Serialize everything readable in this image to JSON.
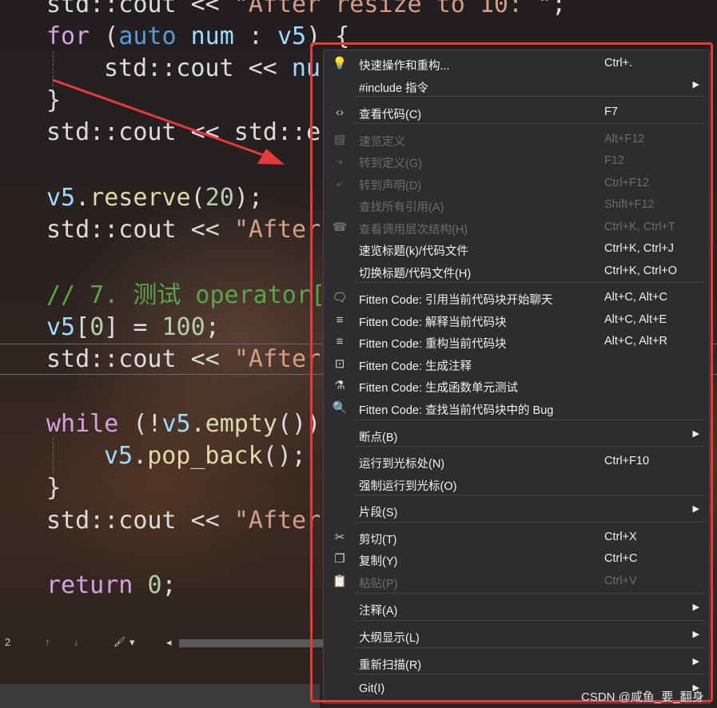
{
  "code": {
    "line1": {
      "a": "std::cout << ",
      "b": "\"After resize to 10: \"",
      "c": ";"
    },
    "line2": {
      "kw": "for",
      "a": " (",
      "auto": "auto",
      "sp": " ",
      "num": "num",
      "c": " : ",
      "v5": "v5",
      "d": ") {"
    },
    "line3": {
      "a": "std::cout << ",
      "b": "nu"
    },
    "line4": "}",
    "line5": {
      "a": "std::cout << std::e"
    },
    "line6": {
      "v5": "v5",
      "a": ".",
      "fn": "reserve",
      "b": "(",
      "num": "20",
      "c": ");"
    },
    "line7": {
      "a": "std::cout << ",
      "b": "\"After"
    },
    "line8": "// 7. 测试 operator[",
    "line9": {
      "v5": "v5",
      "a": "[",
      "i": "0",
      "b": "] = ",
      "num": "100",
      "c": ";"
    },
    "line10": {
      "a": "std::cout << ",
      "b": "\"After"
    },
    "line11": {
      "kw": "while",
      "a": " (!",
      "v5": "v5",
      "b": ".",
      "fn": "empty",
      "c": "())"
    },
    "line12": {
      "v5": "v5",
      "a": ".",
      "fn": "pop_back",
      "b": "();"
    },
    "line13": "}",
    "line14": {
      "a": "std::cout << ",
      "b": "\"After"
    },
    "line15": {
      "kw": "return",
      "a": " ",
      "num": "0",
      "b": ";"
    }
  },
  "statusbar": {
    "line_num": "2",
    "up": "↑",
    "down": "↓",
    "brush": "🖌",
    "dropdown": "▾",
    "left": "◂"
  },
  "menu": {
    "items": [
      {
        "icon": "💡",
        "label": "快速操作和重构...",
        "shortcut": "Ctrl+.",
        "submenu": false,
        "disabled": false
      },
      {
        "icon": "",
        "label": "#include 指令",
        "shortcut": "",
        "submenu": true,
        "disabled": false
      },
      {
        "icon": "‹›",
        "label": "查看代码(C)",
        "shortcut": "F7",
        "submenu": false,
        "disabled": false
      },
      {
        "icon": "▤",
        "label": "速览定义",
        "shortcut": "Alt+F12",
        "submenu": false,
        "disabled": true
      },
      {
        "icon": "⤷",
        "label": "转到定义(G)",
        "shortcut": "F12",
        "submenu": false,
        "disabled": true
      },
      {
        "icon": "⤶",
        "label": "转到声明(D)",
        "shortcut": "Ctrl+F12",
        "submenu": false,
        "disabled": true
      },
      {
        "icon": "",
        "label": "查找所有引用(A)",
        "shortcut": "Shift+F12",
        "submenu": false,
        "disabled": true
      },
      {
        "icon": "☎",
        "label": "查看调用层次结构(H)",
        "shortcut": "Ctrl+K, Ctrl+T",
        "submenu": false,
        "disabled": true
      },
      {
        "icon": "",
        "label": "速览标题(k)/代码文件",
        "shortcut": "Ctrl+K, Ctrl+J",
        "submenu": false,
        "disabled": false
      },
      {
        "icon": "",
        "label": "切换标题/代码文件(H)",
        "shortcut": "Ctrl+K, Ctrl+O",
        "submenu": false,
        "disabled": false
      },
      {
        "icon": "🗨",
        "label": "Fitten Code: 引用当前代码块开始聊天",
        "shortcut": "Alt+C, Alt+C",
        "submenu": false,
        "disabled": false
      },
      {
        "icon": "≡",
        "label": "Fitten Code: 解释当前代码块",
        "shortcut": "Alt+C, Alt+E",
        "submenu": false,
        "disabled": false
      },
      {
        "icon": "≡",
        "label": "Fitten Code: 重构当前代码块",
        "shortcut": "Alt+C, Alt+R",
        "submenu": false,
        "disabled": false
      },
      {
        "icon": "⊡",
        "label": "Fitten Code: 生成注释",
        "shortcut": "",
        "submenu": false,
        "disabled": false
      },
      {
        "icon": "⚗",
        "label": "Fitten Code: 生成函数单元测试",
        "shortcut": "",
        "submenu": false,
        "disabled": false
      },
      {
        "icon": "🔍",
        "label": "Fitten Code: 查找当前代码块中的 Bug",
        "shortcut": "",
        "submenu": false,
        "disabled": false
      },
      {
        "icon": "",
        "label": "断点(B)",
        "shortcut": "",
        "submenu": true,
        "disabled": false
      },
      {
        "icon": "",
        "label": "运行到光标处(N)",
        "shortcut": "Ctrl+F10",
        "submenu": false,
        "disabled": false
      },
      {
        "icon": "",
        "label": "强制运行到光标(O)",
        "shortcut": "",
        "submenu": false,
        "disabled": false
      },
      {
        "icon": "",
        "label": "片段(S)",
        "shortcut": "",
        "submenu": true,
        "disabled": false
      },
      {
        "icon": "✂",
        "label": "剪切(T)",
        "shortcut": "Ctrl+X",
        "submenu": false,
        "disabled": false
      },
      {
        "icon": "❐",
        "label": "复制(Y)",
        "shortcut": "Ctrl+C",
        "submenu": false,
        "disabled": false
      },
      {
        "icon": "📋",
        "label": "粘贴(P)",
        "shortcut": "Ctrl+V",
        "submenu": false,
        "disabled": true
      },
      {
        "icon": "",
        "label": "注释(A)",
        "shortcut": "",
        "submenu": true,
        "disabled": false
      },
      {
        "icon": "",
        "label": "大纲显示(L)",
        "shortcut": "",
        "submenu": true,
        "disabled": false
      },
      {
        "icon": "",
        "label": "重新扫描(R)",
        "shortcut": "",
        "submenu": true,
        "disabled": false
      },
      {
        "icon": "",
        "label": "Git(I)",
        "shortcut": "",
        "submenu": true,
        "disabled": false
      }
    ],
    "submenu_glyph": "▶"
  },
  "colors": {
    "annotation_red": "#e8383b"
  },
  "watermark": "CSDN @咸鱼_要_翻身"
}
